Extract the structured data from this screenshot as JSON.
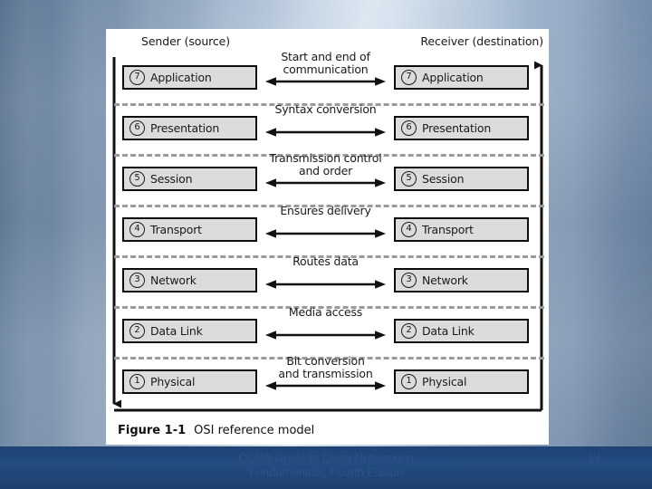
{
  "slide": {
    "background_color": "#8fa3bb"
  },
  "figure": {
    "sender_header": "Sender (source)",
    "receiver_header": "Receiver (destination)",
    "caption_label": "Figure 1-1",
    "caption_title": "OSI reference model",
    "box_fill_color": "#dcdcdc",
    "box_border_color": "#0d0d0d",
    "divider_color": "#9a9a9a",
    "layers": [
      {
        "number": "7",
        "name": "Application",
        "function_line1": "Start and end of",
        "function_line2": "communication"
      },
      {
        "number": "6",
        "name": "Presentation",
        "function_line1": "Syntax conversion",
        "function_line2": ""
      },
      {
        "number": "5",
        "name": "Session",
        "function_line1": "Transmission control",
        "function_line2": "and order"
      },
      {
        "number": "4",
        "name": "Transport",
        "function_line1": "Ensures delivery",
        "function_line2": ""
      },
      {
        "number": "3",
        "name": "Network",
        "function_line1": "Routes data",
        "function_line2": ""
      },
      {
        "number": "2",
        "name": "Data Link",
        "function_line1": "Media access",
        "function_line2": ""
      },
      {
        "number": "1",
        "name": "Physical",
        "function_line1": "Bit conversion",
        "function_line2": "and transmission"
      }
    ]
  },
  "footer": {
    "line1": "CCNA Guide to Cisco Networking",
    "line2": "Fundamentals, Fourth Edition",
    "page_number": "14",
    "band_color": "#1e4273",
    "text_color": "#2c5186"
  }
}
